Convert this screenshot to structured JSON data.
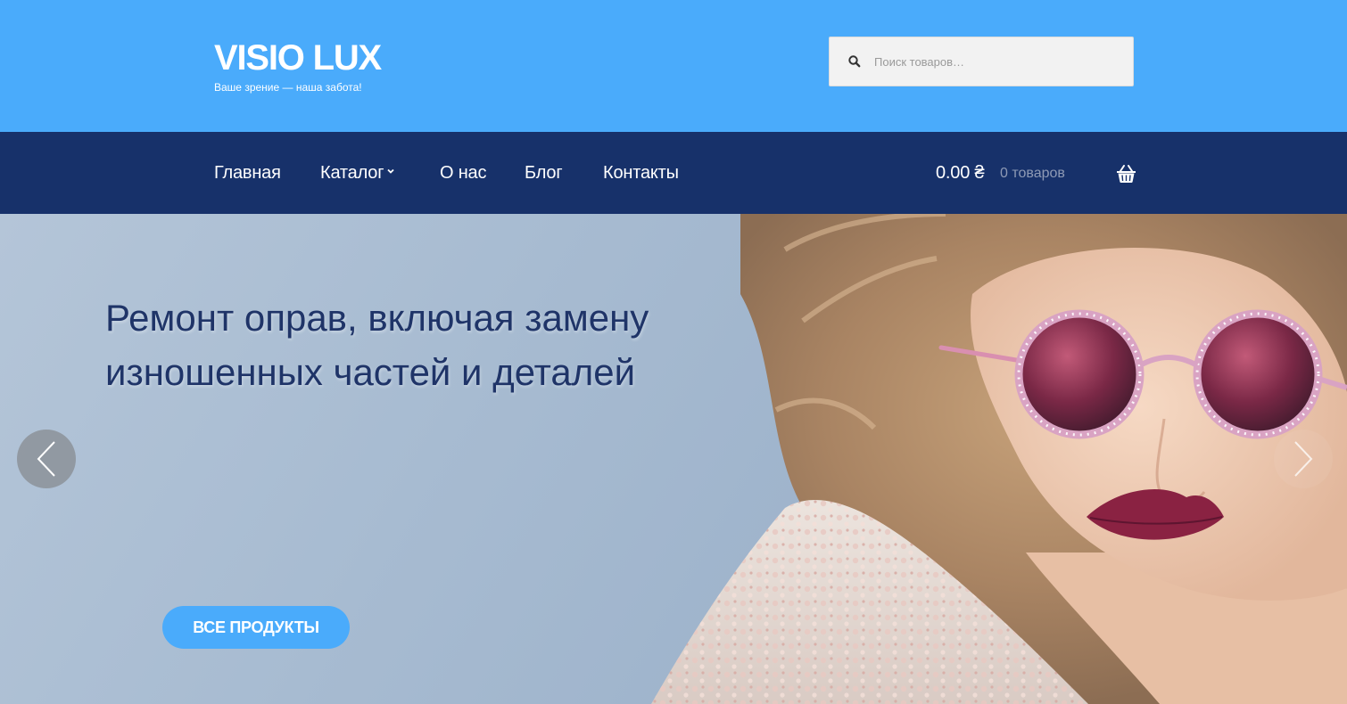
{
  "header": {
    "logo": "VISIO LUX",
    "tagline": "Ваше зрение — наша забота!",
    "search": {
      "placeholder": "Поиск товаров…",
      "value": "",
      "icon": "search-icon"
    }
  },
  "nav": {
    "items": [
      {
        "label": "Главная"
      },
      {
        "label": "Каталог",
        "has_dropdown": true,
        "icon": "chevron-down-icon"
      },
      {
        "label": "О нас"
      },
      {
        "label": "Блог"
      },
      {
        "label": "Контакты"
      }
    ],
    "cart": {
      "total": "0.00 ₴",
      "count": "0 товаров",
      "icon": "basket-icon"
    }
  },
  "hero": {
    "title": "Ремонт оправ, включая замену изношенных частей и деталей",
    "button": "ВСЕ ПРОДУКТЫ",
    "prev_icon": "chevron-left-icon",
    "next_icon": "chevron-right-icon"
  },
  "colors": {
    "header_bg": "#4aabfb",
    "nav_bg": "#17316a",
    "accent": "#4aabfb",
    "hero_text": "#1f3468"
  }
}
